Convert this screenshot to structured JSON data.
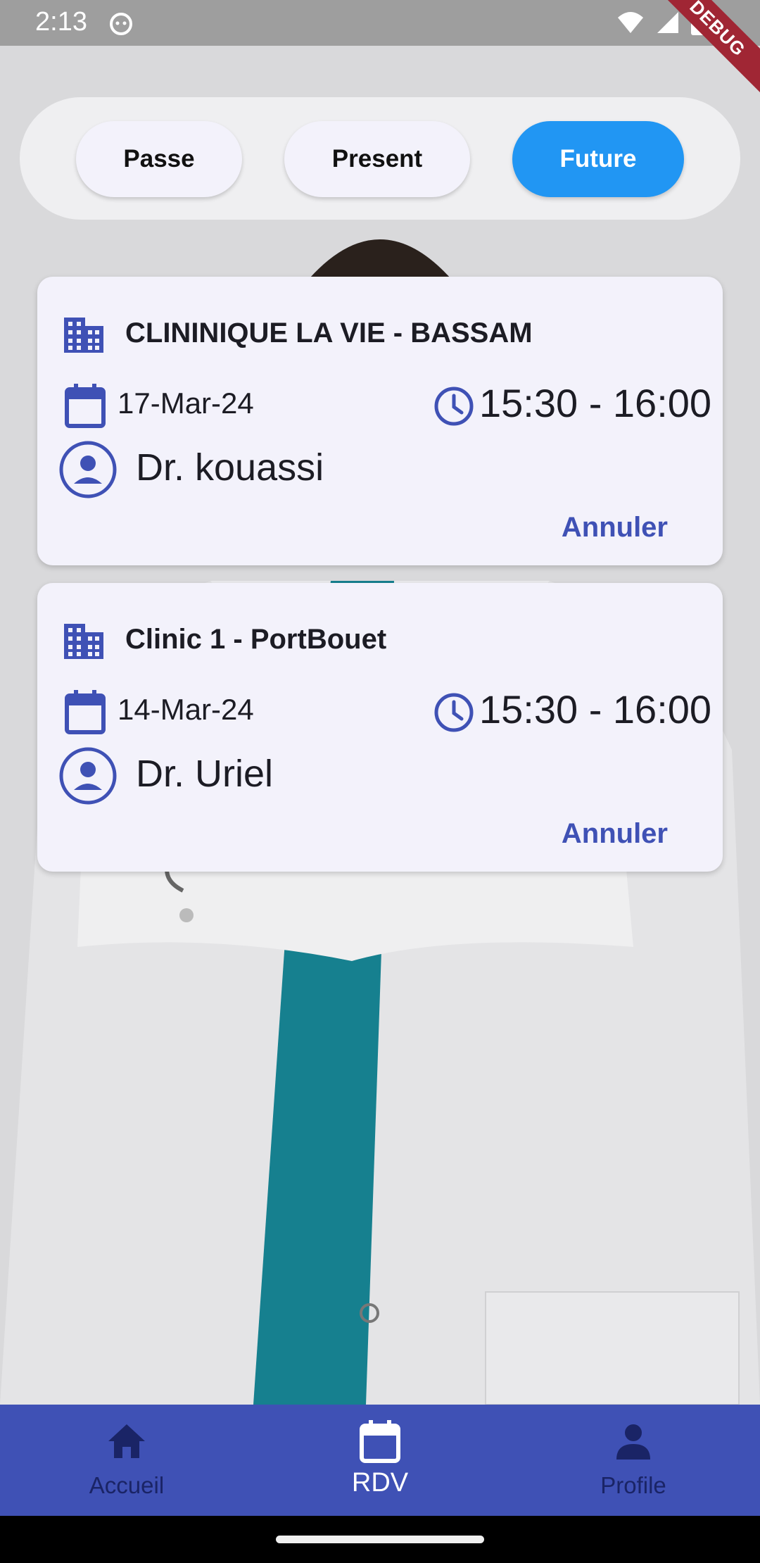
{
  "status_bar": {
    "time": "2:13",
    "debug_label": "DEBUG"
  },
  "tabs": [
    {
      "label": "Passe",
      "active": false
    },
    {
      "label": "Present",
      "active": false
    },
    {
      "label": "Future",
      "active": true
    }
  ],
  "appointments": [
    {
      "clinic": "CLININIQUE LA VIE - BASSAM",
      "date": "17-Mar-24",
      "time": "15:30 - 16:00",
      "doctor": "Dr. kouassi",
      "cancel_label": "Annuler"
    },
    {
      "clinic": "Clinic 1 - PortBouet",
      "date": "14-Mar-24",
      "time": "15:30 - 16:00",
      "doctor": "Dr. Uriel",
      "cancel_label": "Annuler"
    }
  ],
  "bottom_nav": [
    {
      "label": "Accueil",
      "icon": "home-icon",
      "active": false
    },
    {
      "label": "RDV",
      "icon": "calendar-icon",
      "active": true
    },
    {
      "label": "Profile",
      "icon": "person-icon",
      "active": false
    }
  ],
  "colors": {
    "accent": "#2196f3",
    "primary": "#3f51b5",
    "card_bg": "#f3f2fb",
    "nav_inactive": "#1a2466"
  }
}
